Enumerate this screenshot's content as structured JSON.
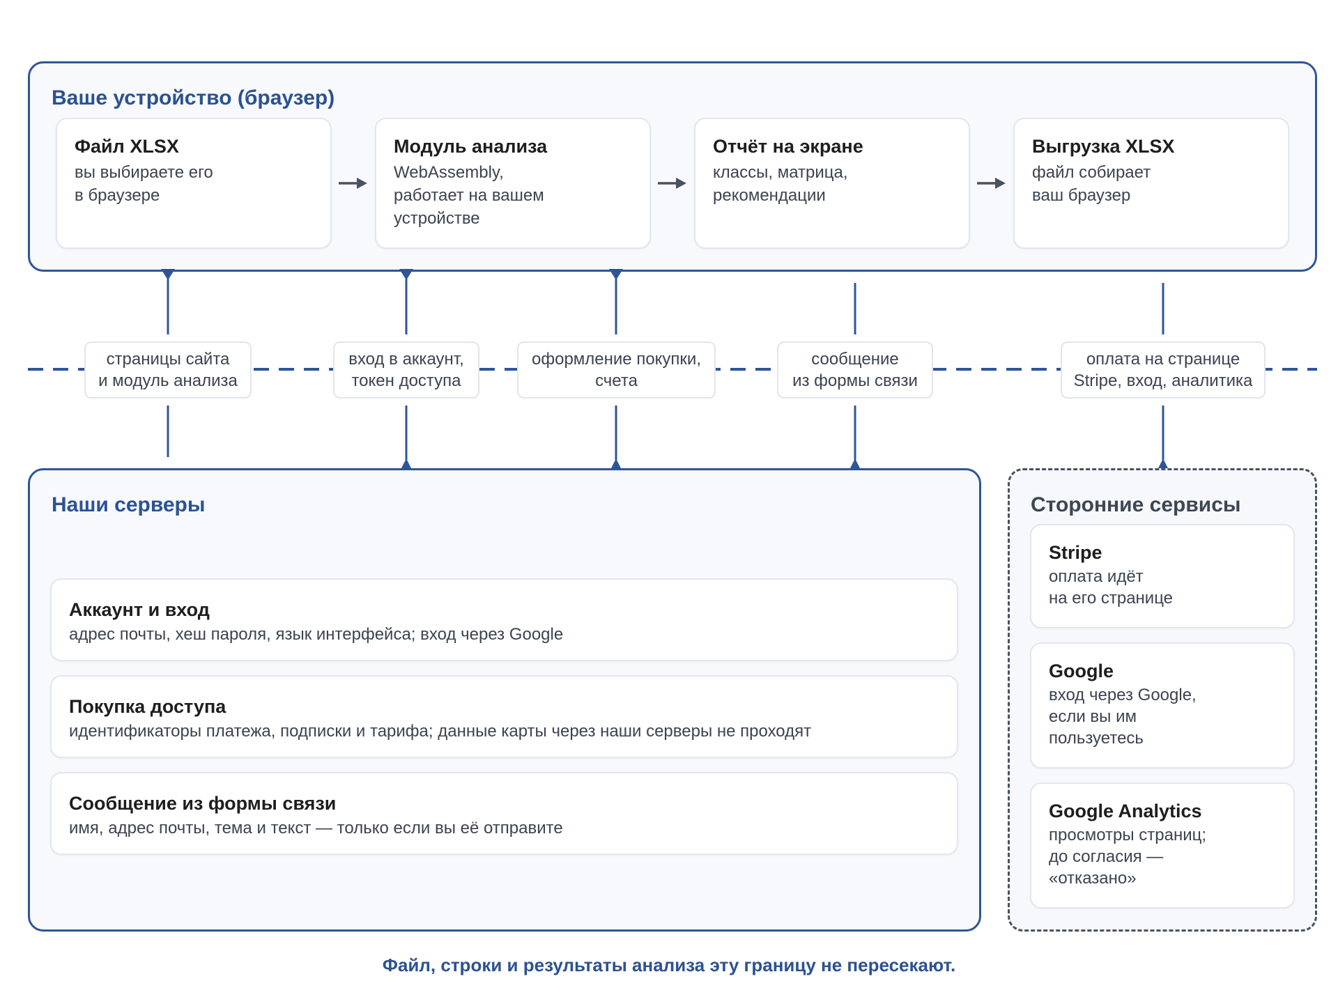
{
  "device": {
    "title": "Ваше устройство (браузер)",
    "steps": [
      {
        "title": "Файл XLSX",
        "desc": "вы выбираете его\nв браузере"
      },
      {
        "title": "Модуль анализа",
        "desc": "WebAssembly,\nработает на вашем\nустройстве"
      },
      {
        "title": "Отчёт на экране",
        "desc": "классы, матрица,\nрекомендации"
      },
      {
        "title": "Выгрузка XLSX",
        "desc": "файл собирает\nваш браузер"
      }
    ]
  },
  "boundary_labels": [
    "страницы сайта\nи модуль анализа",
    "вход в аккаунт,\nтокен доступа",
    "оформление покупки,\nсчета",
    "сообщение\nиз формы связи",
    "оплата на странице\nStripe, вход, аналитика"
  ],
  "servers": {
    "title": "Наши серверы",
    "items": [
      {
        "title": "Аккаунт и вход",
        "desc": "адрес почты, хеш пароля, язык интерфейса; вход через Google"
      },
      {
        "title": "Покупка доступа",
        "desc": "идентификаторы платежа, подписки и тарифа; данные карты через наши серверы не проходят"
      },
      {
        "title": "Сообщение из формы связи",
        "desc": "имя, адрес почты, тема и текст — только если вы её отправите"
      }
    ]
  },
  "third_party": {
    "title": "Сторонние сервисы",
    "items": [
      {
        "title": "Stripe",
        "desc": "оплата идёт\nна его странице"
      },
      {
        "title": "Google",
        "desc": "вход через Google,\nесли вы им\nпользуетесь"
      },
      {
        "title": "Google Analytics",
        "desc": "просмотры страниц;\nдо согласия —\n«отказано»"
      }
    ]
  },
  "footer": "Файл, строки и результаты анализа эту границу не пересекают.",
  "colors": {
    "accent": "#2f5597",
    "arrow": "#4a5260",
    "boundary": "#2f5597"
  }
}
